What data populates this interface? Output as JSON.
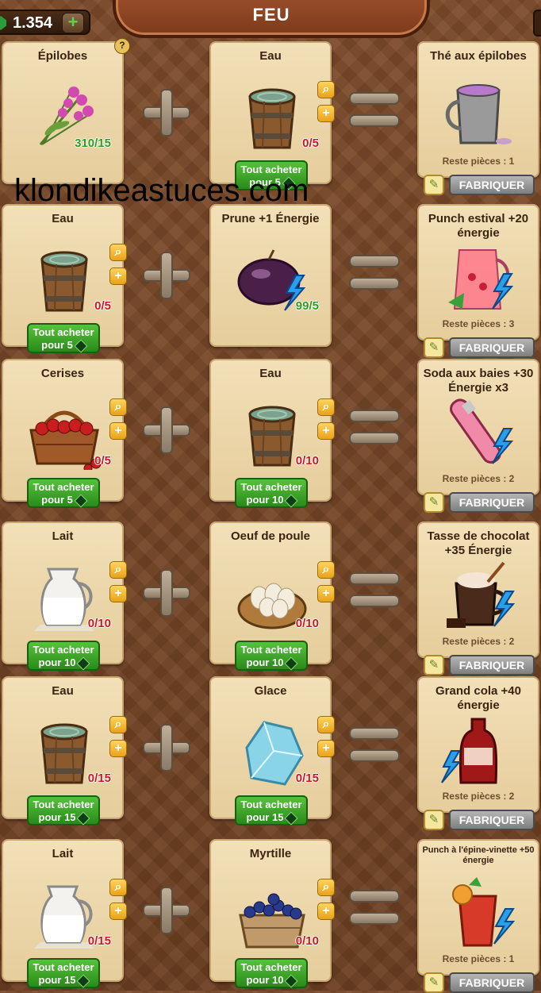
{
  "header": {
    "coins": "1.354",
    "coin_plus": "+",
    "title": "FEU"
  },
  "watermark": "klondikeastuces.com",
  "question_mark": "?",
  "buy_line1": "Tout acheter",
  "craft_label": "FABRIQUER",
  "recipes": [
    {
      "in1": {
        "name": "Épilobes",
        "count": "310/15",
        "enough": true,
        "buy": ""
      },
      "in2": {
        "name": "Eau",
        "count": "0/5",
        "enough": false,
        "buy": "pour 5"
      },
      "out": {
        "name": "Thé aux épilobes",
        "remaining": "Reste pièces : 1",
        "small": false
      }
    },
    {
      "in1": {
        "name": "Eau",
        "count": "0/5",
        "enough": false,
        "buy": "pour 5"
      },
      "in2": {
        "name": "Prune +1 Énergie",
        "count": "99/5",
        "enough": true,
        "buy": ""
      },
      "out": {
        "name": "Punch estival +20 énergie",
        "remaining": "Reste pièces : 3",
        "small": false
      }
    },
    {
      "in1": {
        "name": "Cerises",
        "count": "0/5",
        "enough": false,
        "buy": "pour 5"
      },
      "in2": {
        "name": "Eau",
        "count": "0/10",
        "enough": false,
        "buy": "pour 10"
      },
      "out": {
        "name": "Soda aux baies +30 Énergie x3",
        "remaining": "Reste pièces : 2",
        "small": false
      }
    },
    {
      "in1": {
        "name": "Lait",
        "count": "0/10",
        "enough": false,
        "buy": "pour 10"
      },
      "in2": {
        "name": "Oeuf de poule",
        "count": "0/10",
        "enough": false,
        "buy": "pour 10"
      },
      "out": {
        "name": "Tasse de chocolat +35 Énergie",
        "remaining": "Reste pièces : 2",
        "small": false
      }
    },
    {
      "in1": {
        "name": "Eau",
        "count": "0/15",
        "enough": false,
        "buy": "pour 15"
      },
      "in2": {
        "name": "Glace",
        "count": "0/15",
        "enough": false,
        "buy": "pour 15"
      },
      "out": {
        "name": "Grand cola +40 énergie",
        "remaining": "Reste pièces : 2",
        "small": false
      }
    },
    {
      "in1": {
        "name": "Lait",
        "count": "0/15",
        "enough": false,
        "buy": "pour 15"
      },
      "in2": {
        "name": "Myrtille",
        "count": "0/10",
        "enough": false,
        "buy": "pour 10"
      },
      "out": {
        "name": "Punch à l'épine-vinette +50 énergie",
        "remaining": "Reste pièces : 1",
        "small": true
      }
    }
  ],
  "icons": {
    "in1": [
      "fireweed-bouquet-icon",
      "water-bucket-icon",
      "cherry-basket-icon",
      "milk-jug-icon",
      "water-bucket-icon",
      "milk-jug-icon"
    ],
    "in2": [
      "water-bucket-icon",
      "plum-icon",
      "water-bucket-icon",
      "egg-basket-icon",
      "ice-block-icon",
      "blueberry-basket-icon"
    ],
    "out": [
      "tea-mug-icon",
      "summer-punch-icon",
      "berry-soda-icon",
      "hot-chocolate-icon",
      "cola-bottle-icon",
      "barberry-punch-icon"
    ]
  }
}
